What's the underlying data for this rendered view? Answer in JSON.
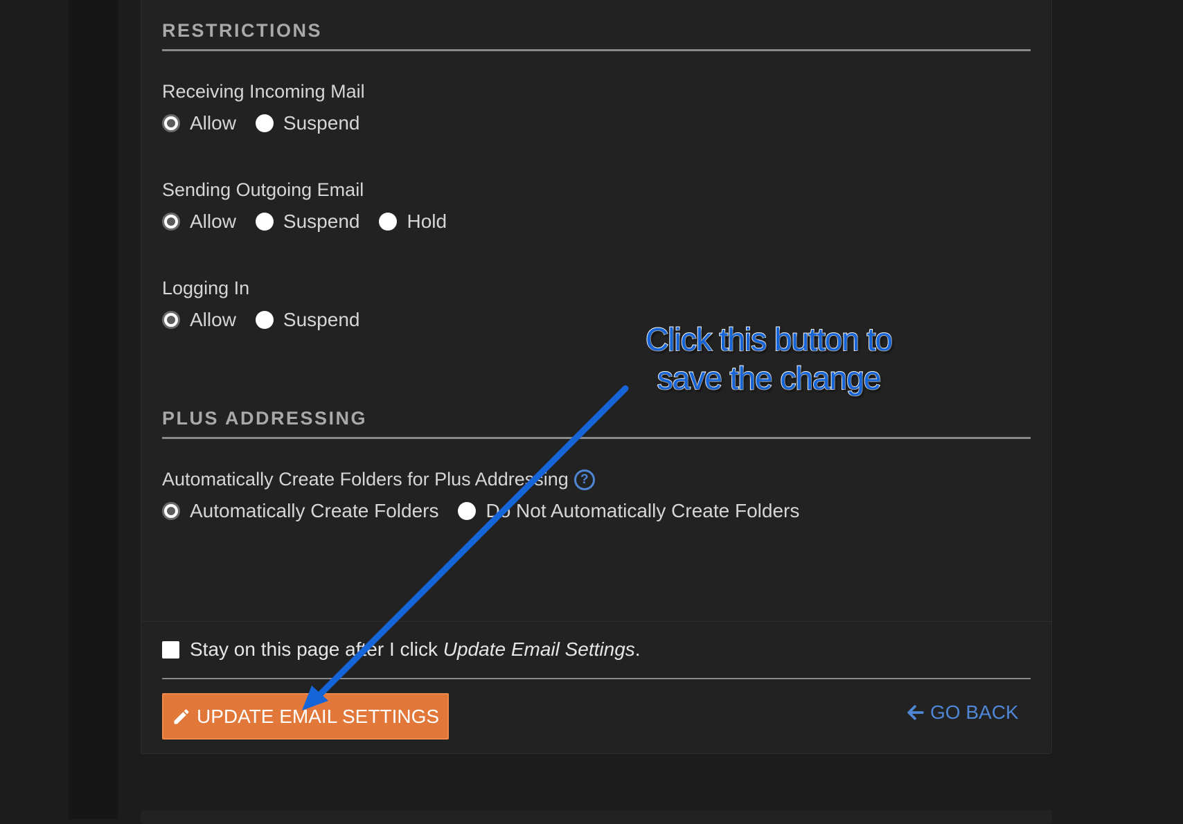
{
  "restrictions": {
    "section_title": "RESTRICTIONS",
    "groups": [
      {
        "label": "Receiving Incoming Mail",
        "options": [
          "Allow",
          "Suspend"
        ],
        "selected": "Allow"
      },
      {
        "label": "Sending Outgoing Email",
        "options": [
          "Allow",
          "Suspend",
          "Hold"
        ],
        "selected": "Allow"
      },
      {
        "label": "Logging In",
        "options": [
          "Allow",
          "Suspend"
        ],
        "selected": "Allow"
      }
    ]
  },
  "plus_addressing": {
    "section_title": "PLUS ADDRESSING",
    "label": "Automatically Create Folders for Plus Addressing",
    "options": [
      "Automatically Create Folders",
      "Do Not Automatically Create Folders"
    ],
    "selected": "Automatically Create Folders",
    "help_icon": "question-circle-icon"
  },
  "footer": {
    "stay_text": "Stay on this page after I click ",
    "stay_emphasis": "Update Email Settings",
    "stay_period": ".",
    "stay_checked": false,
    "update_label": "UPDATE EMAIL SETTINGS",
    "update_icon": "pencil-icon",
    "go_back_label": "GO BACK",
    "go_back_icon": "arrow-left-icon"
  },
  "annotation": {
    "line1": "Click this button to",
    "line2": "save the change"
  },
  "colors": {
    "accent_orange": "#e2773a",
    "link_blue": "#4f86d6",
    "annotation_blue": "#1565d8",
    "background": "#1c1c1c",
    "panel": "#222222"
  }
}
